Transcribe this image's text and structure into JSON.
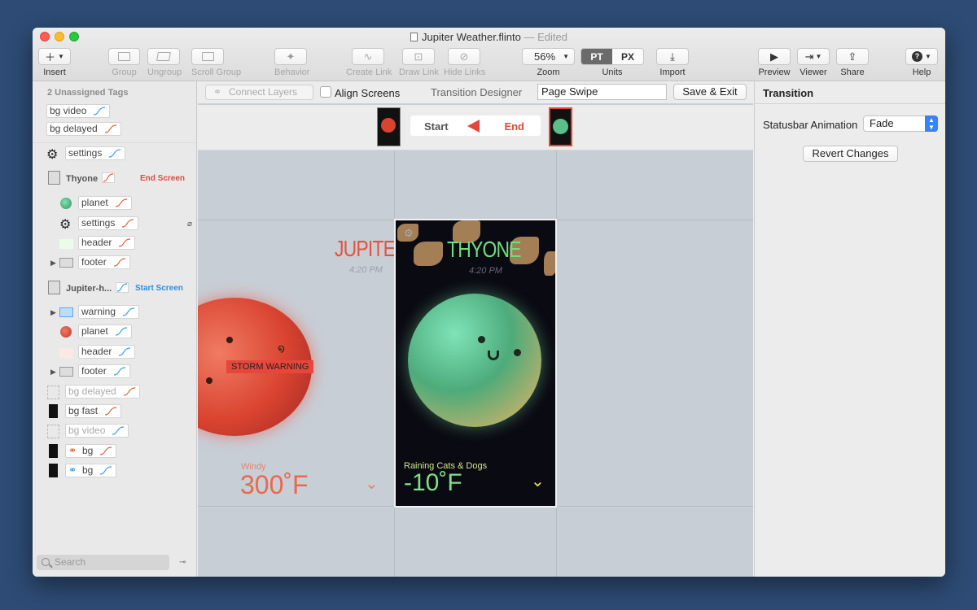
{
  "window": {
    "title": "Jupiter Weather.flinto",
    "edited": "— Edited"
  },
  "toolbar": {
    "insert": "Insert",
    "group": "Group",
    "ungroup": "Ungroup",
    "scroll_group": "Scroll Group",
    "behavior": "Behavior",
    "create_link": "Create Link",
    "draw_link": "Draw Link",
    "hide_links": "Hide Links",
    "zoom_value": "56%",
    "zoom": "Zoom",
    "units_pt": "PT",
    "units_px": "PX",
    "units": "Units",
    "import": "Import",
    "preview": "Preview",
    "viewer": "Viewer",
    "share": "Share",
    "help": "Help"
  },
  "sidebar": {
    "unassigned_header": "2 Unassigned Tags",
    "tag_bg_video": "bg video",
    "tag_bg_delayed": "bg delayed",
    "settings": "settings",
    "thyone_screen": "Thyone",
    "end_screen": "End Screen",
    "thyone_layers": [
      "planet",
      "settings",
      "header",
      "footer"
    ],
    "jupiter_screen": "Jupiter-h...",
    "start_screen": "Start Screen",
    "jupiter_layers": [
      "warning",
      "planet",
      "header",
      "footer",
      "bg delayed",
      "bg fast",
      "bg video",
      "bg",
      "bg"
    ],
    "search_placeholder": "Search"
  },
  "designer": {
    "connect_layers": "Connect Layers",
    "align_screens": "Align Screens",
    "transition_designer": "Transition Designer",
    "transition_name": "Page Swipe",
    "save_exit": "Save & Exit",
    "start": "Start",
    "end": "End"
  },
  "canvas": {
    "jupiter_title": "JUPITER",
    "jupiter_time": "4:20 PM",
    "storm_warning": "STORM WARNING",
    "windy": "Windy",
    "jupiter_temp": "300˚F",
    "thyone_title": "THYONE",
    "thyone_time": "4:20 PM",
    "rain_text": "Raining Cats & Dogs",
    "thyone_temp": "-10˚F"
  },
  "panel": {
    "title": "Transition",
    "statusbar_label": "Statusbar Animation",
    "statusbar_value": "Fade",
    "revert": "Revert Changes"
  },
  "colors": {
    "end_red": "#e14b3c",
    "start_blue": "#2d8ee0",
    "accent_select": "#3b82f6"
  }
}
